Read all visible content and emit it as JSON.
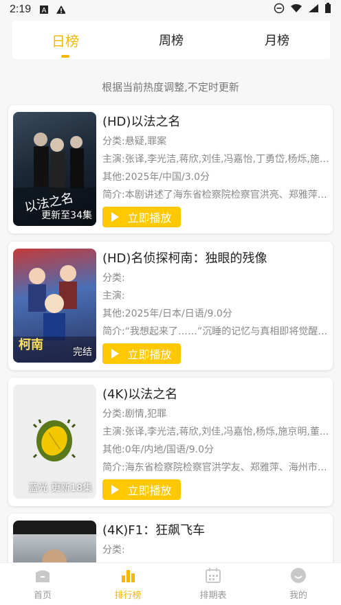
{
  "status": {
    "time": "2:19"
  },
  "tabs": [
    {
      "label": "日榜",
      "active": true
    },
    {
      "label": "周榜",
      "active": false
    },
    {
      "label": "月榜",
      "active": false
    }
  ],
  "subtitle": "根据当前热度调整,不定时更新",
  "cards": [
    {
      "title": "(HD)以法之名",
      "category": "分类:悬疑,罪案",
      "cast": "主演:张译,李光洁,蒋欣,刘佳,冯嘉怡,丁勇岱,杨烁,施京明,董...",
      "other": "其他:2025年/中国/3.0分",
      "intro": "简介:本剧讲述了海东省检察院检察官洪亮、郑雅萍、海州市检...",
      "badge": "更新至34集",
      "poster_text": "以法之名",
      "play": "立即播放"
    },
    {
      "title": "(HD)名侦探柯南：独眼的残像",
      "category": "分类:",
      "cast": "主演:",
      "other": "其他:2025年/日本/日语/9.0分",
      "intro": "简介:“我想起来了……”沉睡的记忆与真相即将觉醒。长野县...",
      "badge": "完结",
      "poster_text": "柯南",
      "play": "立即播放"
    },
    {
      "title": "(4K)以法之名",
      "category": "分类:剧情,犯罪",
      "cast": "主演:张译,李光洁,蒋欣,刘佳,冯嘉怡,杨烁,施京明,董...",
      "other": "其他:0年/内地/国语/9.0分",
      "intro": "简介:海东省检察院检察官洪学友、郑雅萍、海州市检察院...",
      "badge": "蓝光 更新18集",
      "poster_text": "",
      "play": "立即播放"
    },
    {
      "title": "(4K)F1：狂飙飞车",
      "category": "分类:",
      "cast": "",
      "other": "",
      "intro": "",
      "badge": "",
      "poster_text": "",
      "play": ""
    }
  ],
  "nav": [
    {
      "label": "首页",
      "icon": "home-icon",
      "active": false
    },
    {
      "label": "排行榜",
      "icon": "ranking-icon",
      "active": true
    },
    {
      "label": "排期表",
      "icon": "calendar-icon",
      "active": false
    },
    {
      "label": "我的",
      "icon": "profile-icon",
      "active": false
    }
  ],
  "colors": {
    "accent": "#f5b800",
    "button": "#ffc800"
  }
}
